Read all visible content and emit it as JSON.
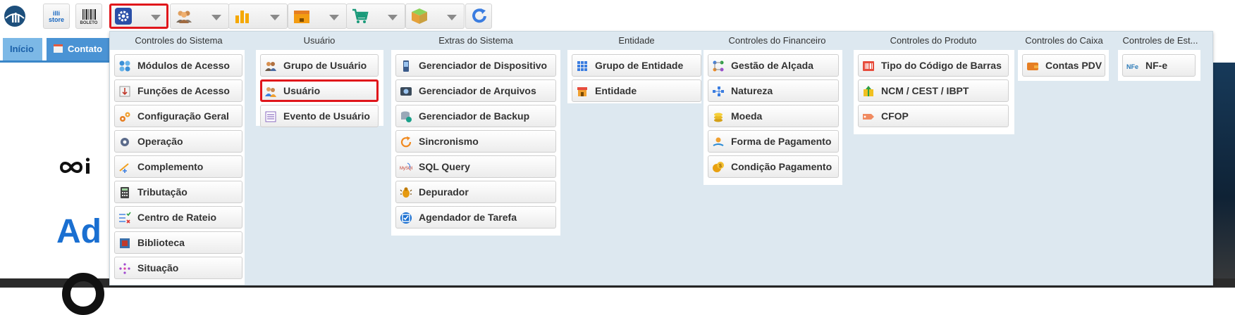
{
  "toolbar": {
    "buttons": [
      "illi-logo-icon",
      "illi-store-icon",
      "boleto-icon",
      "settings-gear-icon",
      "users-icon",
      "bar-chart-icon",
      "box-icon",
      "cart-icon",
      "package-icon",
      "refresh-icon"
    ],
    "store_text": [
      "illi",
      "store"
    ],
    "boleto_text": "BOLETO"
  },
  "tabs": {
    "home": "Início",
    "contact": "Contato A"
  },
  "background": {
    "brand_mark": "∞i",
    "title": "Ad"
  },
  "menu": {
    "columns": [
      {
        "header": "Controles do Sistema",
        "items": [
          {
            "label": "Módulos de Acesso",
            "icon": "modules-icon"
          },
          {
            "label": "Funções de Acesso",
            "icon": "functions-icon"
          },
          {
            "label": "Configuração Geral",
            "icon": "gears-icon"
          },
          {
            "label": "Operação",
            "icon": "operation-gear-icon"
          },
          {
            "label": "Complemento",
            "icon": "complement-icon"
          },
          {
            "label": "Tributação",
            "icon": "calculator-icon"
          },
          {
            "label": "Centro de Rateio",
            "icon": "checklist-icon"
          },
          {
            "label": "Biblioteca",
            "icon": "library-icon"
          },
          {
            "label": "Situação",
            "icon": "situation-icon"
          }
        ]
      },
      {
        "header": "Usuário",
        "items": [
          {
            "label": "Grupo de Usuário",
            "icon": "user-group-icon"
          },
          {
            "label": "Usuário",
            "icon": "user-icon"
          },
          {
            "label": "Evento de Usuário",
            "icon": "user-event-icon"
          }
        ]
      },
      {
        "header": "Extras do Sistema",
        "items": [
          {
            "label": "Gerenciador de Dispositivo",
            "icon": "device-icon"
          },
          {
            "label": "Gerenciador de Arquivos",
            "icon": "files-icon"
          },
          {
            "label": "Gerenciador de Backup",
            "icon": "backup-icon"
          },
          {
            "label": "Sincronismo",
            "icon": "sync-icon"
          },
          {
            "label": "SQL Query",
            "icon": "sql-icon"
          },
          {
            "label": "Depurador",
            "icon": "bug-icon"
          },
          {
            "label": "Agendador de Tarefa",
            "icon": "task-scheduler-icon"
          }
        ]
      },
      {
        "header": "Entidade",
        "items": [
          {
            "label": "Grupo de Entidade",
            "icon": "entity-group-icon"
          },
          {
            "label": "Entidade",
            "icon": "store-icon"
          }
        ]
      },
      {
        "header": "Controles do Financeiro",
        "items": [
          {
            "label": "Gestão de Alçada",
            "icon": "hierarchy-icon"
          },
          {
            "label": "Natureza",
            "icon": "nature-icon"
          },
          {
            "label": "Moeda",
            "icon": "coins-icon"
          },
          {
            "label": "Forma de Pagamento",
            "icon": "payment-icon"
          },
          {
            "label": "Condição Pagamento",
            "icon": "payment-condition-icon"
          }
        ]
      },
      {
        "header": "Controles do Produto",
        "items": [
          {
            "label": "Tipo do Código de Barras",
            "icon": "barcode-icon"
          },
          {
            "label": "NCM / CEST / IBPT",
            "icon": "ncm-icon"
          },
          {
            "label": "CFOP",
            "icon": "tag-icon"
          }
        ]
      },
      {
        "header": "Controles do Caixa",
        "items": [
          {
            "label": "Contas PDV",
            "icon": "wallet-icon"
          }
        ]
      },
      {
        "header": "Controles de Est...",
        "items": [
          {
            "label": "NF-e",
            "icon": "nfe-icon"
          }
        ]
      }
    ]
  }
}
